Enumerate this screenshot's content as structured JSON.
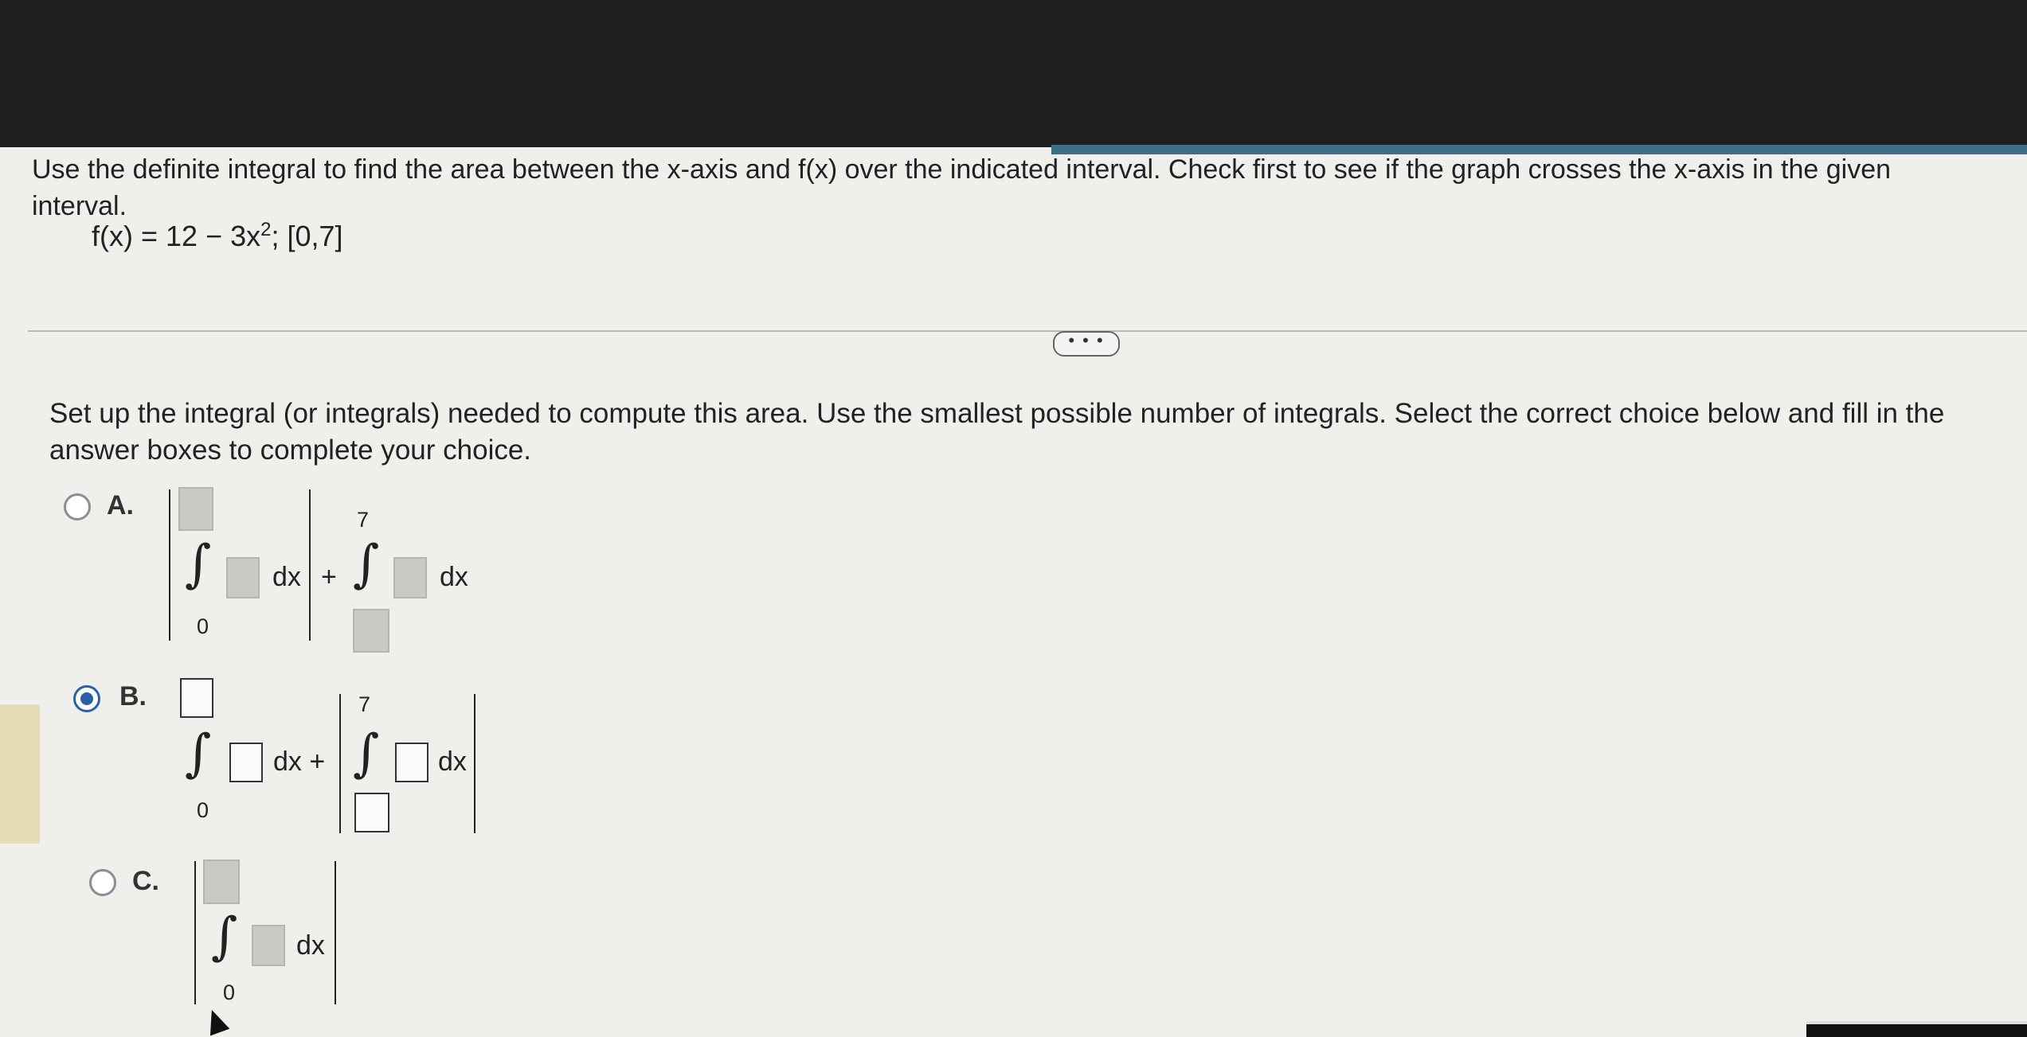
{
  "question": {
    "text": "Use the definite integral to find the area between the x-axis and f(x) over the indicated interval. Check first to see if the graph crosses the x-axis in the given interval.",
    "function_prefix": "f(x) = 12 − 3x",
    "function_exponent": "2",
    "function_suffix": "; [0,7]"
  },
  "more_button": {
    "label": "• • •"
  },
  "instructions": "Set up the integral (or integrals) needed to compute this area. Use the smallest possible number of integrals. Select the correct choice below and fill in the answer boxes to complete your choice.",
  "choices": [
    {
      "label": "A.",
      "selected": false,
      "first_lower": "0",
      "first_dx": "dx",
      "plus": "+",
      "second_upper": "7",
      "second_dx": "dx"
    },
    {
      "label": "B.",
      "selected": true,
      "first_lower": "0",
      "first_dx": "dx +",
      "second_upper": "7",
      "second_dx": "dx"
    },
    {
      "label": "C.",
      "selected": false,
      "lower": "0",
      "dx": "dx"
    }
  ],
  "integral_symbol": "∫"
}
